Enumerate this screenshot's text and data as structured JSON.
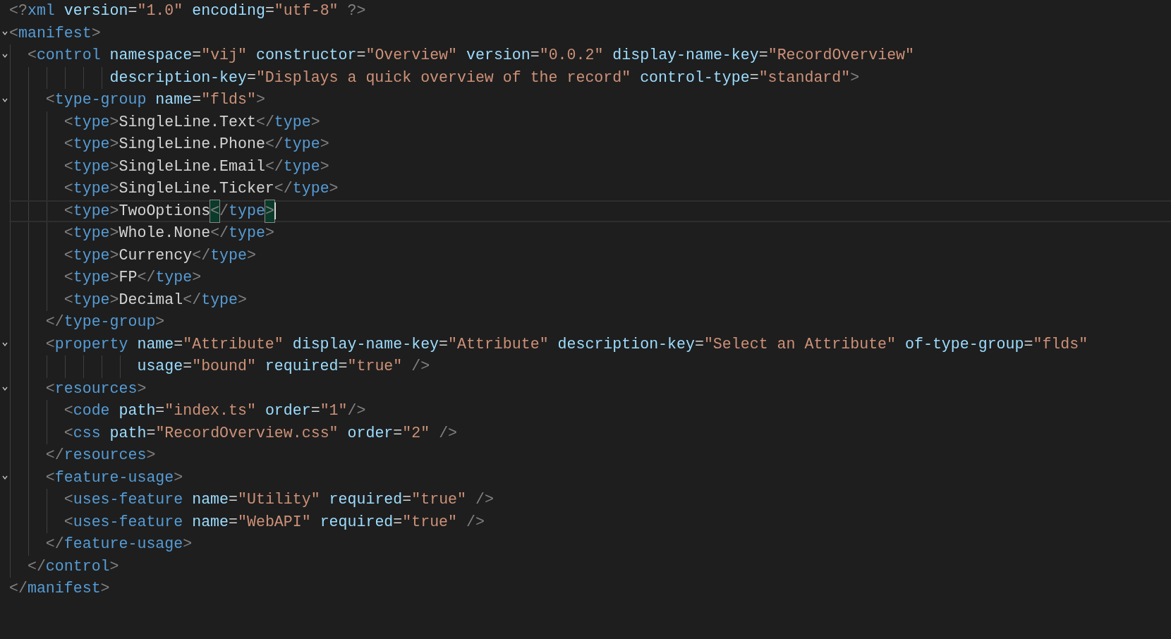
{
  "editor": {
    "lines": [
      {
        "selected": false,
        "fold": false,
        "tokens": [
          {
            "kind": "punct",
            "text": "<?"
          },
          {
            "kind": "tag",
            "text": "xml"
          },
          {
            "kind": "attr",
            "text": " version"
          },
          {
            "kind": "text",
            "text": "="
          },
          {
            "kind": "string",
            "text": "\"1.0\""
          },
          {
            "kind": "attr",
            "text": " encoding"
          },
          {
            "kind": "text",
            "text": "="
          },
          {
            "kind": "string",
            "text": "\"utf-8\""
          },
          {
            "kind": "punct",
            "text": " ?>"
          }
        ]
      },
      {
        "selected": false,
        "fold": true,
        "tokens": [
          {
            "kind": "punct",
            "text": "<"
          },
          {
            "kind": "tag",
            "text": "manifest"
          },
          {
            "kind": "punct",
            "text": ">"
          }
        ]
      },
      {
        "selected": false,
        "fold": true,
        "tokens": [
          {
            "kind": "punct",
            "text": "  <"
          },
          {
            "kind": "tag",
            "text": "control"
          },
          {
            "kind": "attr",
            "text": " namespace"
          },
          {
            "kind": "text",
            "text": "="
          },
          {
            "kind": "string",
            "text": "\"vij\""
          },
          {
            "kind": "attr",
            "text": " constructor"
          },
          {
            "kind": "text",
            "text": "="
          },
          {
            "kind": "string",
            "text": "\"Overview\""
          },
          {
            "kind": "attr",
            "text": " version"
          },
          {
            "kind": "text",
            "text": "="
          },
          {
            "kind": "string",
            "text": "\"0.0.2\""
          },
          {
            "kind": "attr",
            "text": " display-name-key"
          },
          {
            "kind": "text",
            "text": "="
          },
          {
            "kind": "string",
            "text": "\"RecordOverview\""
          }
        ]
      },
      {
        "selected": false,
        "fold": false,
        "tokens": [
          {
            "kind": "attr",
            "text": "           description-key"
          },
          {
            "kind": "text",
            "text": "="
          },
          {
            "kind": "string",
            "text": "\"Displays a quick overview of the record\""
          },
          {
            "kind": "attr",
            "text": " control-type"
          },
          {
            "kind": "text",
            "text": "="
          },
          {
            "kind": "string",
            "text": "\"standard\""
          },
          {
            "kind": "punct",
            "text": ">"
          }
        ]
      },
      {
        "selected": false,
        "fold": true,
        "tokens": [
          {
            "kind": "punct",
            "text": "    <"
          },
          {
            "kind": "tag",
            "text": "type-group"
          },
          {
            "kind": "attr",
            "text": " name"
          },
          {
            "kind": "text",
            "text": "="
          },
          {
            "kind": "string",
            "text": "\"flds\""
          },
          {
            "kind": "punct",
            "text": ">"
          }
        ]
      },
      {
        "selected": false,
        "fold": false,
        "tokens": [
          {
            "kind": "punct",
            "text": "      <"
          },
          {
            "kind": "tag",
            "text": "type"
          },
          {
            "kind": "punct",
            "text": ">"
          },
          {
            "kind": "text",
            "text": "SingleLine.Text"
          },
          {
            "kind": "punct",
            "text": "</"
          },
          {
            "kind": "tag",
            "text": "type"
          },
          {
            "kind": "punct",
            "text": ">"
          }
        ]
      },
      {
        "selected": false,
        "fold": false,
        "tokens": [
          {
            "kind": "punct",
            "text": "      <"
          },
          {
            "kind": "tag",
            "text": "type"
          },
          {
            "kind": "punct",
            "text": ">"
          },
          {
            "kind": "text",
            "text": "SingleLine.Phone"
          },
          {
            "kind": "punct",
            "text": "</"
          },
          {
            "kind": "tag",
            "text": "type"
          },
          {
            "kind": "punct",
            "text": ">"
          }
        ]
      },
      {
        "selected": false,
        "fold": false,
        "tokens": [
          {
            "kind": "punct",
            "text": "      <"
          },
          {
            "kind": "tag",
            "text": "type"
          },
          {
            "kind": "punct",
            "text": ">"
          },
          {
            "kind": "text",
            "text": "SingleLine.Email"
          },
          {
            "kind": "punct",
            "text": "</"
          },
          {
            "kind": "tag",
            "text": "type"
          },
          {
            "kind": "punct",
            "text": ">"
          }
        ]
      },
      {
        "selected": false,
        "fold": false,
        "tokens": [
          {
            "kind": "punct",
            "text": "      <"
          },
          {
            "kind": "tag",
            "text": "type"
          },
          {
            "kind": "punct",
            "text": ">"
          },
          {
            "kind": "text",
            "text": "SingleLine.Ticker"
          },
          {
            "kind": "punct",
            "text": "</"
          },
          {
            "kind": "tag",
            "text": "type"
          },
          {
            "kind": "punct",
            "text": ">"
          }
        ]
      },
      {
        "selected": true,
        "fold": false,
        "tokens": [
          {
            "kind": "punct",
            "text": "      <"
          },
          {
            "kind": "tag",
            "text": "type"
          },
          {
            "kind": "punct",
            "text": ">"
          },
          {
            "kind": "text",
            "text": "TwoOptions"
          },
          {
            "kind": "bracket",
            "text": "<"
          },
          {
            "kind": "punct",
            "text": "/"
          },
          {
            "kind": "tag",
            "text": "type"
          },
          {
            "kind": "bracket",
            "text": ">"
          }
        ]
      },
      {
        "selected": false,
        "fold": false,
        "tokens": [
          {
            "kind": "punct",
            "text": "      <"
          },
          {
            "kind": "tag",
            "text": "type"
          },
          {
            "kind": "punct",
            "text": ">"
          },
          {
            "kind": "text",
            "text": "Whole.None"
          },
          {
            "kind": "punct",
            "text": "</"
          },
          {
            "kind": "tag",
            "text": "type"
          },
          {
            "kind": "punct",
            "text": ">"
          }
        ]
      },
      {
        "selected": false,
        "fold": false,
        "tokens": [
          {
            "kind": "punct",
            "text": "      <"
          },
          {
            "kind": "tag",
            "text": "type"
          },
          {
            "kind": "punct",
            "text": ">"
          },
          {
            "kind": "text",
            "text": "Currency"
          },
          {
            "kind": "punct",
            "text": "</"
          },
          {
            "kind": "tag",
            "text": "type"
          },
          {
            "kind": "punct",
            "text": ">"
          }
        ]
      },
      {
        "selected": false,
        "fold": false,
        "tokens": [
          {
            "kind": "punct",
            "text": "      <"
          },
          {
            "kind": "tag",
            "text": "type"
          },
          {
            "kind": "punct",
            "text": ">"
          },
          {
            "kind": "text",
            "text": "FP"
          },
          {
            "kind": "punct",
            "text": "</"
          },
          {
            "kind": "tag",
            "text": "type"
          },
          {
            "kind": "punct",
            "text": ">"
          }
        ]
      },
      {
        "selected": false,
        "fold": false,
        "tokens": [
          {
            "kind": "punct",
            "text": "      <"
          },
          {
            "kind": "tag",
            "text": "type"
          },
          {
            "kind": "punct",
            "text": ">"
          },
          {
            "kind": "text",
            "text": "Decimal"
          },
          {
            "kind": "punct",
            "text": "</"
          },
          {
            "kind": "tag",
            "text": "type"
          },
          {
            "kind": "punct",
            "text": ">"
          }
        ]
      },
      {
        "selected": false,
        "fold": false,
        "tokens": [
          {
            "kind": "punct",
            "text": "    </"
          },
          {
            "kind": "tag",
            "text": "type-group"
          },
          {
            "kind": "punct",
            "text": ">"
          }
        ]
      },
      {
        "selected": false,
        "fold": true,
        "tokens": [
          {
            "kind": "punct",
            "text": "    <"
          },
          {
            "kind": "tag",
            "text": "property"
          },
          {
            "kind": "attr",
            "text": " name"
          },
          {
            "kind": "text",
            "text": "="
          },
          {
            "kind": "string",
            "text": "\"Attribute\""
          },
          {
            "kind": "attr",
            "text": " display-name-key"
          },
          {
            "kind": "text",
            "text": "="
          },
          {
            "kind": "string",
            "text": "\"Attribute\""
          },
          {
            "kind": "attr",
            "text": " description-key"
          },
          {
            "kind": "text",
            "text": "="
          },
          {
            "kind": "string",
            "text": "\"Select an Attribute\""
          },
          {
            "kind": "attr",
            "text": " of-type-group"
          },
          {
            "kind": "text",
            "text": "="
          },
          {
            "kind": "string",
            "text": "\"flds\""
          }
        ]
      },
      {
        "selected": false,
        "fold": false,
        "tokens": [
          {
            "kind": "attr",
            "text": "              usage"
          },
          {
            "kind": "text",
            "text": "="
          },
          {
            "kind": "string",
            "text": "\"bound\""
          },
          {
            "kind": "attr",
            "text": " required"
          },
          {
            "kind": "text",
            "text": "="
          },
          {
            "kind": "string",
            "text": "\"true\""
          },
          {
            "kind": "punct",
            "text": " />"
          }
        ]
      },
      {
        "selected": false,
        "fold": true,
        "tokens": [
          {
            "kind": "punct",
            "text": "    <"
          },
          {
            "kind": "tag",
            "text": "resources"
          },
          {
            "kind": "punct",
            "text": ">"
          }
        ]
      },
      {
        "selected": false,
        "fold": false,
        "tokens": [
          {
            "kind": "punct",
            "text": "      <"
          },
          {
            "kind": "tag",
            "text": "code"
          },
          {
            "kind": "attr",
            "text": " path"
          },
          {
            "kind": "text",
            "text": "="
          },
          {
            "kind": "string",
            "text": "\"index.ts\""
          },
          {
            "kind": "attr",
            "text": " order"
          },
          {
            "kind": "text",
            "text": "="
          },
          {
            "kind": "string",
            "text": "\"1\""
          },
          {
            "kind": "punct",
            "text": "/>"
          }
        ]
      },
      {
        "selected": false,
        "fold": false,
        "tokens": [
          {
            "kind": "punct",
            "text": "      <"
          },
          {
            "kind": "tag",
            "text": "css"
          },
          {
            "kind": "attr",
            "text": " path"
          },
          {
            "kind": "text",
            "text": "="
          },
          {
            "kind": "string",
            "text": "\"RecordOverview.css\""
          },
          {
            "kind": "attr",
            "text": " order"
          },
          {
            "kind": "text",
            "text": "="
          },
          {
            "kind": "string",
            "text": "\"2\""
          },
          {
            "kind": "punct",
            "text": " />"
          }
        ]
      },
      {
        "selected": false,
        "fold": false,
        "tokens": [
          {
            "kind": "punct",
            "text": "    </"
          },
          {
            "kind": "tag",
            "text": "resources"
          },
          {
            "kind": "punct",
            "text": ">"
          }
        ]
      },
      {
        "selected": false,
        "fold": true,
        "tokens": [
          {
            "kind": "punct",
            "text": "    <"
          },
          {
            "kind": "tag",
            "text": "feature-usage"
          },
          {
            "kind": "punct",
            "text": ">"
          }
        ]
      },
      {
        "selected": false,
        "fold": false,
        "tokens": [
          {
            "kind": "punct",
            "text": "      <"
          },
          {
            "kind": "tag",
            "text": "uses-feature"
          },
          {
            "kind": "attr",
            "text": " name"
          },
          {
            "kind": "text",
            "text": "="
          },
          {
            "kind": "string",
            "text": "\"Utility\""
          },
          {
            "kind": "attr",
            "text": " required"
          },
          {
            "kind": "text",
            "text": "="
          },
          {
            "kind": "string",
            "text": "\"true\""
          },
          {
            "kind": "punct",
            "text": " />"
          }
        ]
      },
      {
        "selected": false,
        "fold": false,
        "tokens": [
          {
            "kind": "punct",
            "text": "      <"
          },
          {
            "kind": "tag",
            "text": "uses-feature"
          },
          {
            "kind": "attr",
            "text": " name"
          },
          {
            "kind": "text",
            "text": "="
          },
          {
            "kind": "string",
            "text": "\"WebAPI\""
          },
          {
            "kind": "attr",
            "text": " required"
          },
          {
            "kind": "text",
            "text": "="
          },
          {
            "kind": "string",
            "text": "\"true\""
          },
          {
            "kind": "punct",
            "text": " />"
          }
        ]
      },
      {
        "selected": false,
        "fold": false,
        "tokens": [
          {
            "kind": "punct",
            "text": "    </"
          },
          {
            "kind": "tag",
            "text": "feature-usage"
          },
          {
            "kind": "punct",
            "text": ">"
          }
        ]
      },
      {
        "selected": false,
        "fold": false,
        "tokens": [
          {
            "kind": "punct",
            "text": "  </"
          },
          {
            "kind": "tag",
            "text": "control"
          },
          {
            "kind": "punct",
            "text": ">"
          }
        ]
      },
      {
        "selected": false,
        "fold": false,
        "tokens": [
          {
            "kind": "punct",
            "text": "</"
          },
          {
            "kind": "tag",
            "text": "manifest"
          },
          {
            "kind": "punct",
            "text": ">"
          }
        ]
      }
    ]
  }
}
